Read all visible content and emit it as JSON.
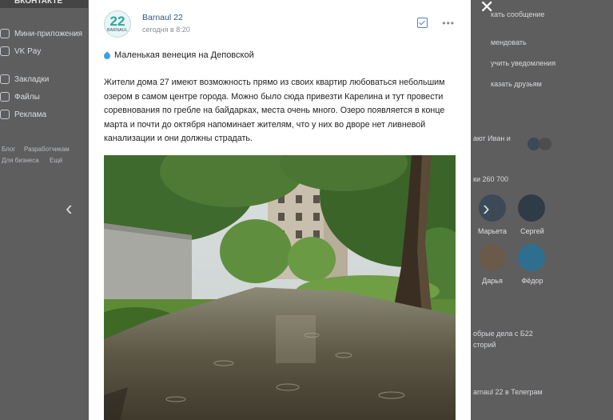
{
  "background": {
    "logo_text": "ВКОНТАКТЕ",
    "sidebar_items": [
      "Мини-приложения",
      "VK Pay",
      "Закладки",
      "Файлы",
      "Реклама"
    ],
    "footer_links": [
      "Блог",
      "Разработчикам",
      "Для бизнеса",
      "Ещё"
    ],
    "right_texts": {
      "send_message": "кать сообщение",
      "recommend": "мендовать",
      "notifications": "учить уведомления",
      "tell_friends": "казать друзьям",
      "followers_friends": "ают Иван и",
      "followers_count": "ки 260 700",
      "good_deeds_1": "обрые дела с Б22",
      "good_deeds_2": "сторий",
      "telegram": "arnaul 22 в Телеграм"
    },
    "followers": [
      "Марьета",
      "Сергей",
      "Дарья",
      "Фёдор"
    ]
  },
  "post": {
    "author": "Barnaul 22",
    "time": "сегодня в 8:20",
    "logo_number": "22",
    "logo_word": "BARNAUL",
    "title": "Маленькая венеция на Деповской",
    "body": "Жители дома 27 имеют возможность прямо из своих квартир любоваться небольшим озером в самом центре города. Можно было сюда привезти Карелина и тут провести соревнования по гребле на байдарках, места очень много. Озеро появляется в конце марта и почти до октября напоминает жителям, что у них во дворе нет ливневой канализации и они должны страдать."
  },
  "icons": {
    "close": "close-icon",
    "prev": "chevron-left-icon",
    "next": "chevron-right-icon",
    "bookmark": "checkbox-icon",
    "more": "more-dots-icon",
    "drop": "water-drop-icon"
  },
  "colors": {
    "link": "#2a5885",
    "accent": "#2ba6a3",
    "overlay": "#5e5e5e"
  }
}
